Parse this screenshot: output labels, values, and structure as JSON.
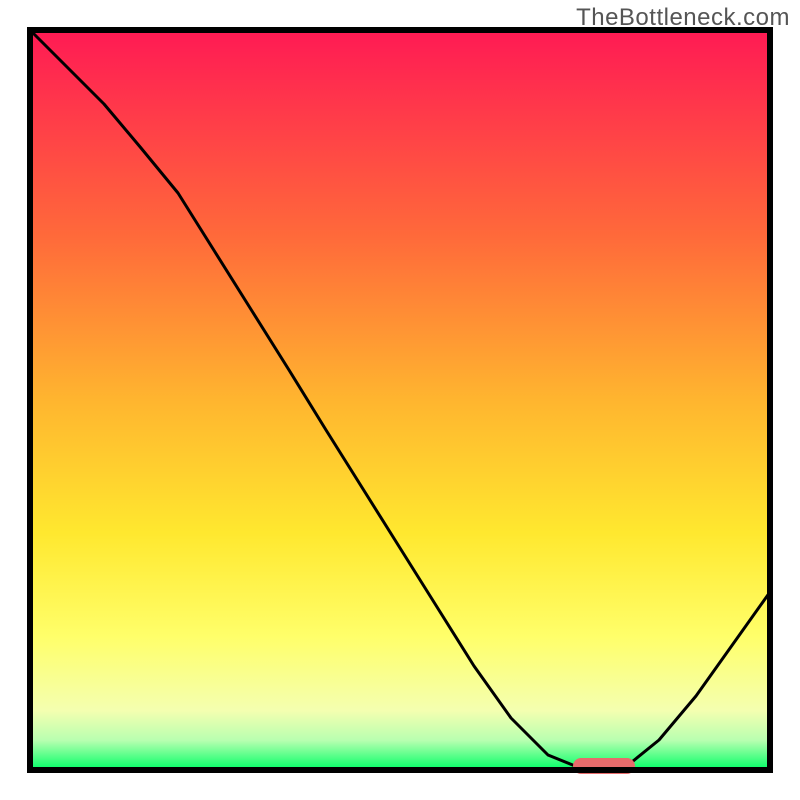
{
  "watermark": "TheBottleneck.com",
  "chart_data": {
    "type": "line",
    "title": "",
    "xlabel": "",
    "ylabel": "",
    "categories": [
      0,
      5,
      10,
      15,
      20,
      25,
      30,
      35,
      40,
      45,
      50,
      55,
      60,
      65,
      70,
      75,
      80,
      85,
      90,
      95,
      100
    ],
    "values": [
      100,
      95,
      90,
      84,
      78,
      70,
      62,
      54,
      46,
      38,
      30,
      22,
      14,
      7,
      2,
      0,
      0,
      4,
      10,
      17,
      24
    ],
    "xlim": [
      0,
      100
    ],
    "ylim": [
      0,
      100
    ],
    "optimal_marker": {
      "x": 77,
      "width": 7,
      "color": "#e76b6b"
    },
    "background_gradient": {
      "top": "#ff1a54",
      "mid_upper": "#ff8a2f",
      "mid": "#ffe82f",
      "lower": "#ffff8f",
      "bottom": "#00ff66"
    },
    "curve_color": "#000000",
    "frame_color": "#000000"
  }
}
